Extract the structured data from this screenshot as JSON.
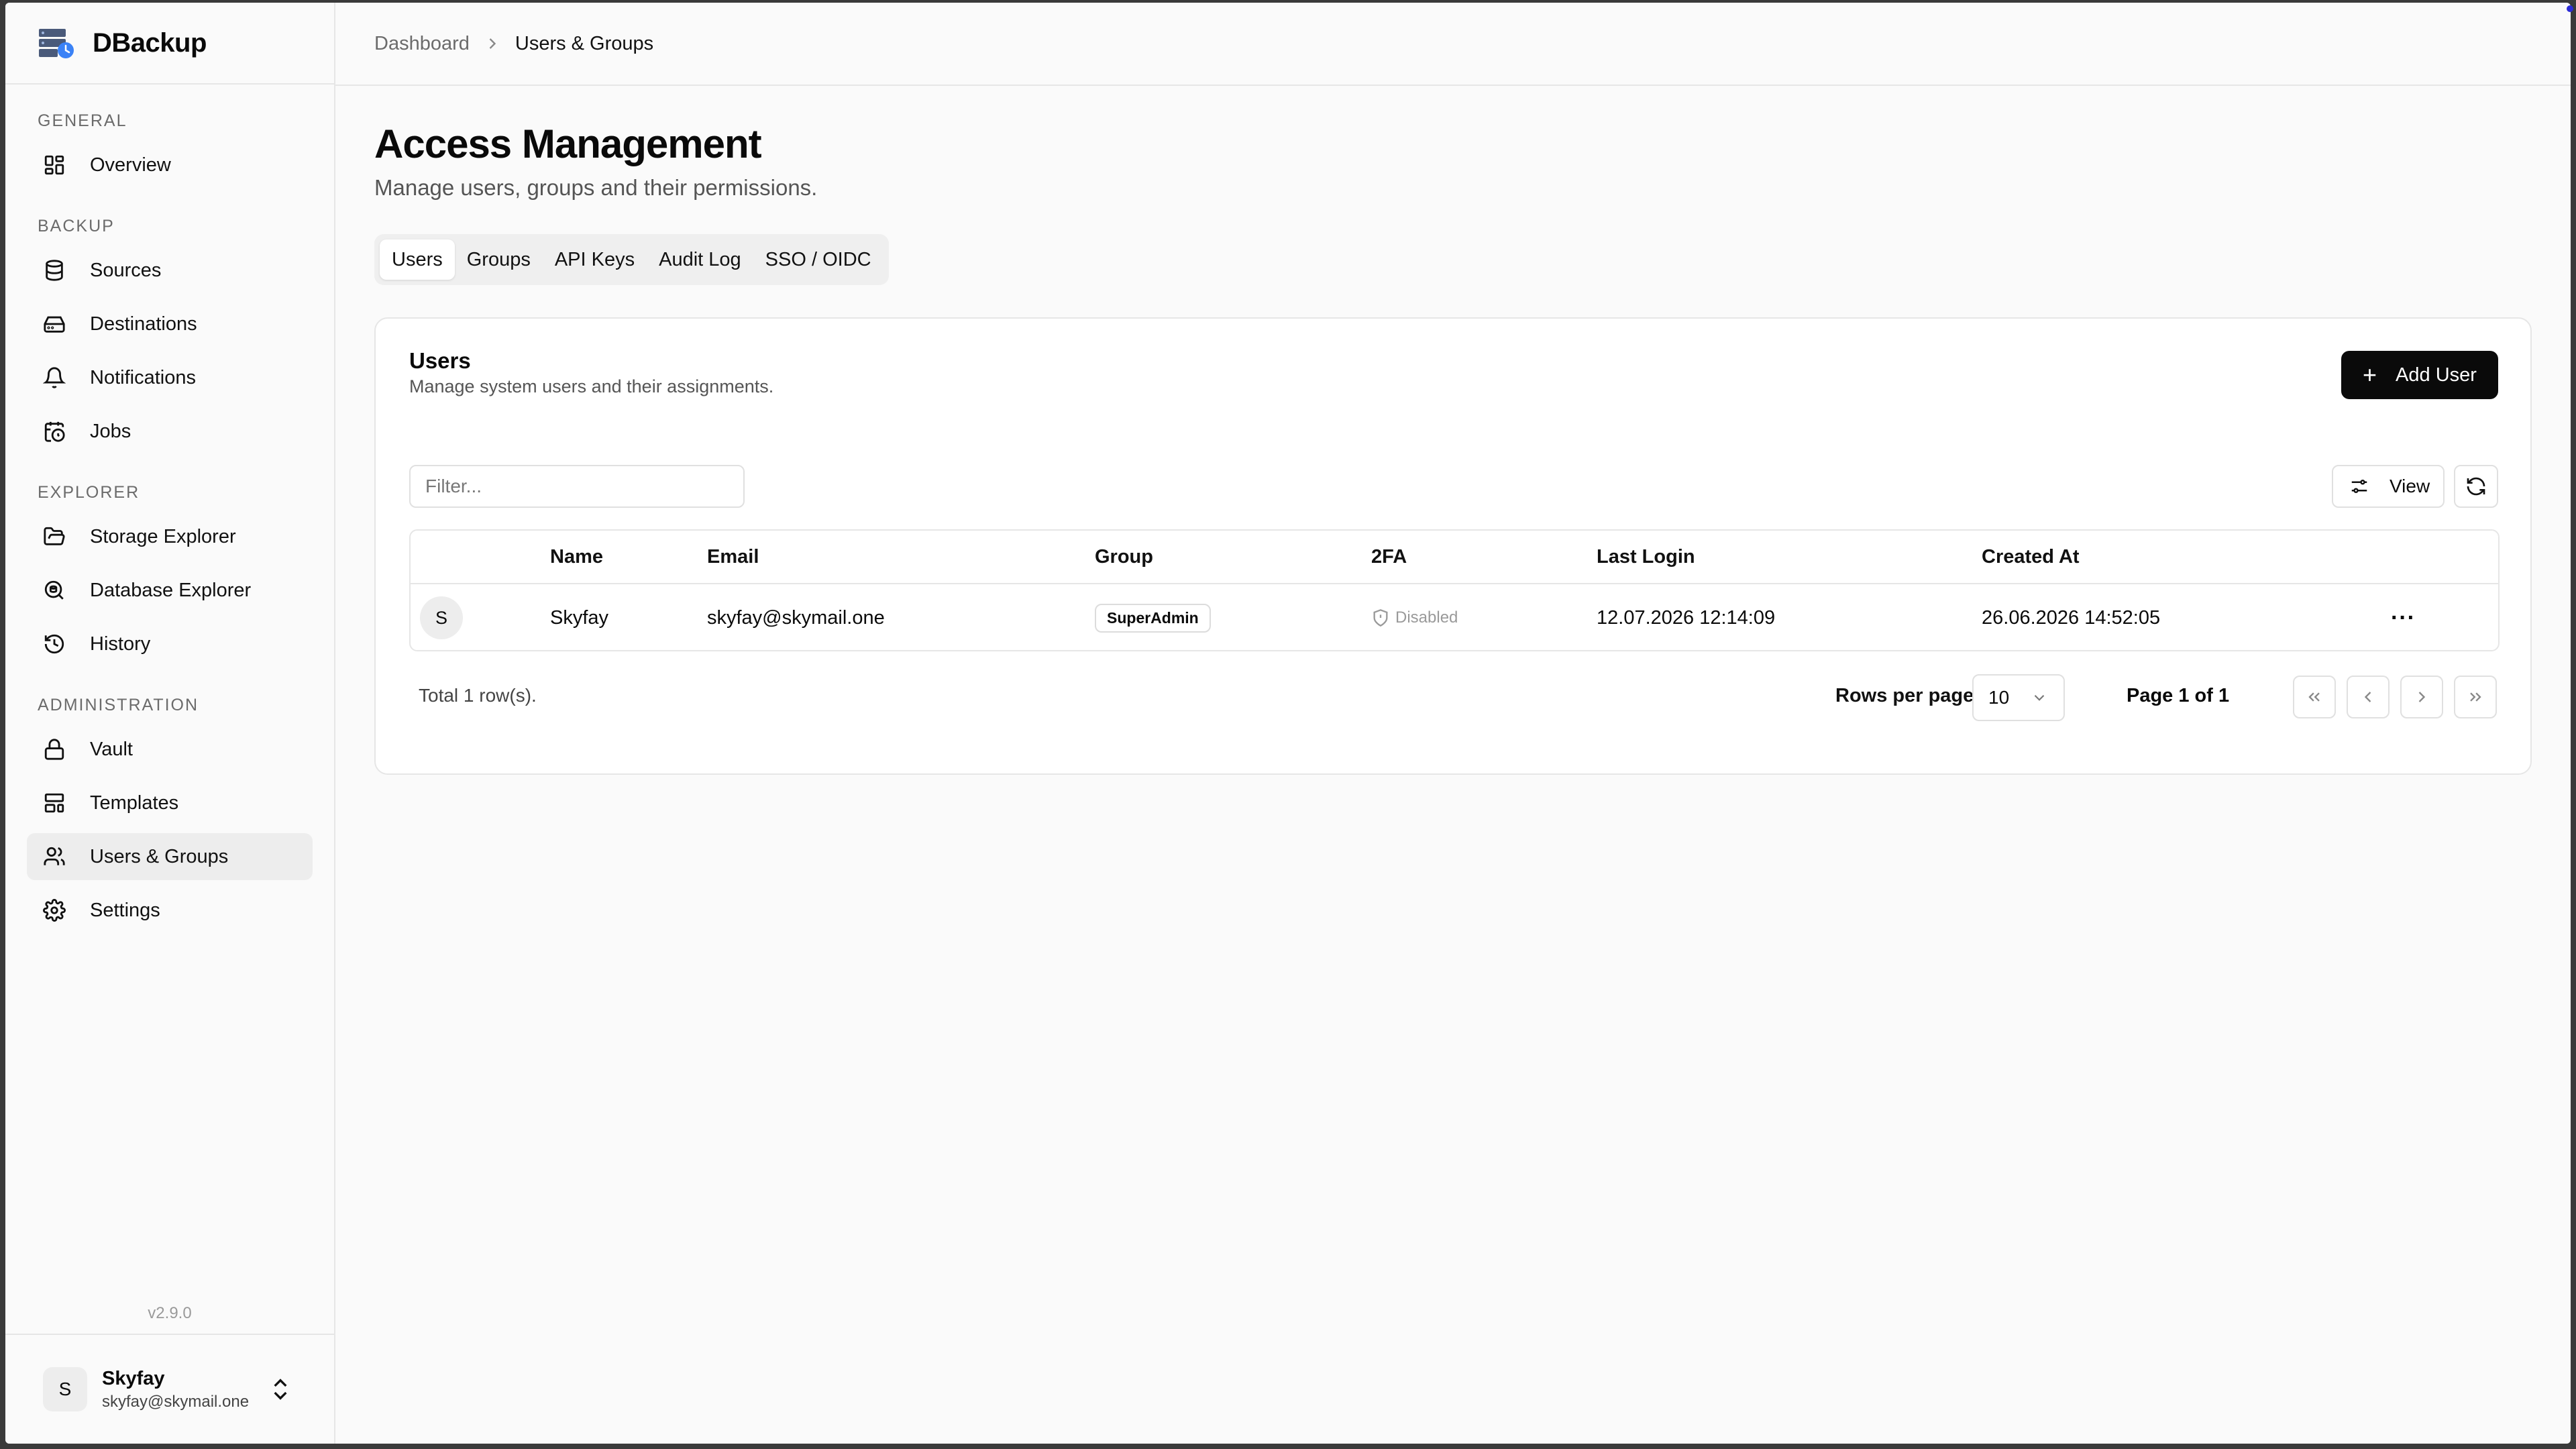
{
  "app": {
    "name": "DBackup",
    "version": "v2.9.0"
  },
  "sidebar": {
    "groups": [
      {
        "label": "GENERAL",
        "items": [
          {
            "label": "Overview",
            "icon": "grid-icon"
          }
        ]
      },
      {
        "label": "BACKUP",
        "items": [
          {
            "label": "Sources",
            "icon": "database-icon"
          },
          {
            "label": "Destinations",
            "icon": "hard-drive-icon"
          },
          {
            "label": "Notifications",
            "icon": "bell-icon"
          },
          {
            "label": "Jobs",
            "icon": "calendar-clock-icon"
          }
        ]
      },
      {
        "label": "EXPLORER",
        "items": [
          {
            "label": "Storage Explorer",
            "icon": "folder-open-icon"
          },
          {
            "label": "Database Explorer",
            "icon": "search-database-icon"
          },
          {
            "label": "History",
            "icon": "history-icon"
          }
        ]
      },
      {
        "label": "ADMINISTRATION",
        "items": [
          {
            "label": "Vault",
            "icon": "lock-icon"
          },
          {
            "label": "Templates",
            "icon": "layout-template-icon"
          },
          {
            "label": "Users & Groups",
            "icon": "users-icon",
            "active": true
          },
          {
            "label": "Settings",
            "icon": "gear-icon"
          }
        ]
      }
    ]
  },
  "user": {
    "initial": "S",
    "name": "Skyfay",
    "email": "skyfay@skymail.one"
  },
  "breadcrumb": {
    "parent": "Dashboard",
    "current": "Users & Groups"
  },
  "page": {
    "title": "Access Management",
    "subtitle": "Manage users, groups and their permissions."
  },
  "tabs": [
    {
      "label": "Users",
      "active": true
    },
    {
      "label": "Groups"
    },
    {
      "label": "API Keys"
    },
    {
      "label": "Audit Log"
    },
    {
      "label": "SSO / OIDC"
    }
  ],
  "card": {
    "title": "Users",
    "subtitle": "Manage system users and their assignments.",
    "add_label": "Add User",
    "filter_placeholder": "Filter...",
    "view_label": "View"
  },
  "table": {
    "columns": [
      "Name",
      "Email",
      "Group",
      "2FA",
      "Last Login",
      "Created At"
    ],
    "rows": [
      {
        "initial": "S",
        "name": "Skyfay",
        "email": "skyfay@skymail.one",
        "group": "SuperAdmin",
        "twofa": "Disabled",
        "last_login": "12.07.2026 12:14:09",
        "created_at": "26.06.2026 14:52:05"
      }
    ],
    "total": "Total 1 row(s).",
    "rows_per_page_label": "Rows per page",
    "rows_per_page": "10",
    "page_label": "Page 1 of 1"
  },
  "colors": {
    "primary": "#0a0a0a",
    "background": "#fafafa",
    "border": "#e6e6e6",
    "muted": "#6b6b6b"
  }
}
